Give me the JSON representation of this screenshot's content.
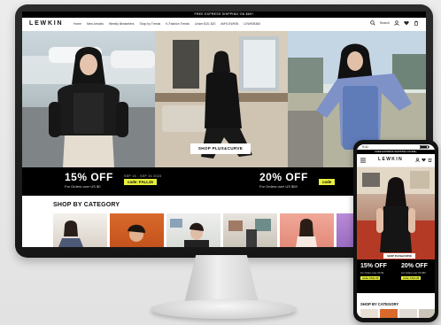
{
  "site": {
    "topbar_text": "FREE EXPRESS SHIPPING ON $69+",
    "logo": "LEWKIN",
    "nav": [
      "Home",
      "New Arrivals",
      "Weekly Bestsellers",
      "Shop by Trends",
      "K-Fashion Trends",
      "Under $15, $20",
      "#MYLEWKIN",
      "LEWKIN360"
    ],
    "search_label": "Search"
  },
  "hero": {
    "shop_button": "SHOP PLUS&CURVE"
  },
  "promo": {
    "left_pct": "15% OFF",
    "left_sub": "For Orders over US $0",
    "left_code": "code: FALL15",
    "center_note": "SEP 15 - SEP 30 2023",
    "right_pct": "20% OFF",
    "right_sub": "For Orders over US $59",
    "right_code": "code"
  },
  "category": {
    "title": "SHOP BY CATEGORY"
  },
  "phone": {
    "time": "9:41",
    "topbar_text": "FREE EXPRESS SHIPPING ON $69+",
    "logo": "LEWKIN",
    "shop_button": "SHOP PLUS&CURVE",
    "left_pct": "15% OFF",
    "left_sub": "For Orders over US $0",
    "left_code": "code: FALL15",
    "right_pct": "20% OFF",
    "right_sub": "For Orders over US $59",
    "right_code": "code: FALL20",
    "category_title": "SHOP BY CATEGORY"
  },
  "colors": {
    "accent_yellow": "#e7f03a",
    "black": "#000000"
  }
}
